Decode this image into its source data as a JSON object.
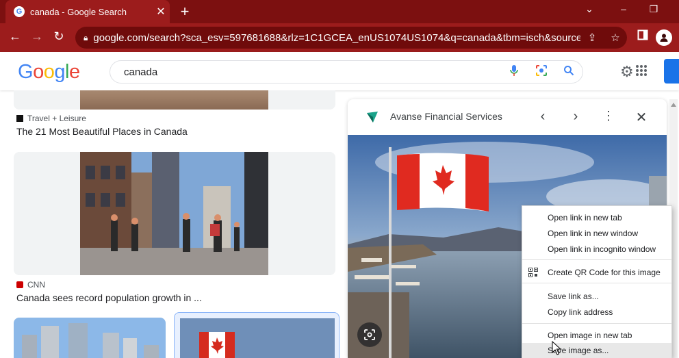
{
  "browser": {
    "tab_title": "canada - Google Search",
    "favicon_letter": "G",
    "close_glyph": "✕",
    "newtab_glyph": "+",
    "url": "google.com/search?sca_esv=597681688&rlz=1C1GCEA_enUS1074US1074&q=canada&tbm=isch&source=lnms...",
    "window_controls": [
      "chevron-down-icon",
      "minimize-icon",
      "restore-icon"
    ]
  },
  "google": {
    "logo_letters": [
      "G",
      "o",
      "o",
      "g",
      "l",
      "e"
    ],
    "logo_colors": [
      "#4285F4",
      "#EA4335",
      "#FBBC05",
      "#4285F4",
      "#34A853",
      "#EA4335"
    ],
    "query": "canada"
  },
  "results": [
    {
      "source": "Travel + Leisure",
      "title": "The 21 Most Beautiful Places in Canada"
    },
    {
      "source": "CNN",
      "title": "Canada sees record population growth in ..."
    }
  ],
  "panel": {
    "site_name": "Avanse Financial Services"
  },
  "context_menu": {
    "items": [
      "Open link in new tab",
      "Open link in new window",
      "Open link in incognito window",
      "Create QR Code for this image",
      "Save link as...",
      "Copy link address",
      "Open image in new tab",
      "Save image as..."
    ],
    "hovered_index": 7
  },
  "colors": {
    "chrome_frame": "#7c1010",
    "chrome_toolbar": "#9c1c1c",
    "omnibox": "#6f0b0b",
    "accent_blue": "#1a73e8"
  }
}
